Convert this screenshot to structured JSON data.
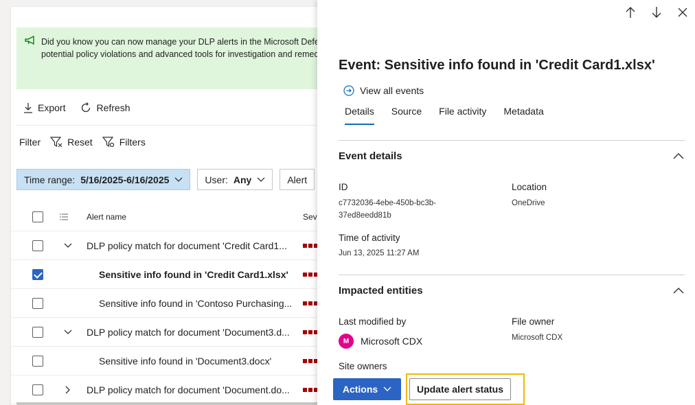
{
  "left": {
    "banner_line1": "Did you know you can now manage your DLP alerts in the Microsoft Defende",
    "banner_line2": "potential policy violations and advanced tools for investigation and remediati",
    "toolbar": {
      "export": "Export",
      "refresh": "Refresh"
    },
    "filter": {
      "label": "Filter",
      "reset": "Reset",
      "filters": "Filters"
    },
    "chips": {
      "time_label": "Time range:",
      "time_value": "5/16/2025-6/16/2025",
      "user_label": "User:",
      "user_value": "Any",
      "alert_label": "Alert"
    },
    "table": {
      "col_alert_name": "Alert name",
      "col_severity": "Seve",
      "rows": [
        {
          "name": "DLP policy match for document 'Credit Card1...",
          "type": "parent",
          "expanded": true,
          "checked": false
        },
        {
          "name": "Sensitive info found in 'Credit Card1.xlsx'",
          "type": "child",
          "checked": true
        },
        {
          "name": "Sensitive info found in 'Contoso Purchasing...",
          "type": "child",
          "checked": false
        },
        {
          "name": "DLP policy match for document 'Document3.d...",
          "type": "parent",
          "expanded": true,
          "checked": false
        },
        {
          "name": "Sensitive info found in 'Document3.docx'",
          "type": "child",
          "checked": false
        },
        {
          "name": "DLP policy match for document 'Document.do...",
          "type": "parent",
          "expanded": false,
          "checked": false
        }
      ]
    }
  },
  "panel": {
    "title": "Event: Sensitive info found in 'Credit Card1.xlsx'",
    "view_all": "View all events",
    "tabs": [
      "Details",
      "Source",
      "File activity",
      "Metadata"
    ],
    "active_tab": "Details",
    "event_details": {
      "heading": "Event details",
      "id_label": "ID",
      "id_line1": "c7732036-4ebe-450b-bc3b-",
      "id_line2": "37ed8eedd81b",
      "location_label": "Location",
      "location_value": "OneDrive",
      "time_label": "Time of activity",
      "time_value": "Jun 13, 2025 11:27 AM"
    },
    "impacted": {
      "heading": "Impacted entities",
      "modified_label": "Last modified by",
      "modified_initial": "M",
      "modified_value": "Microsoft CDX",
      "owner_label": "File owner",
      "owner_value": "Microsoft CDX",
      "site_owners_label": "Site owners"
    },
    "footer": {
      "actions": "Actions",
      "update": "Update alert status",
      "highlight_color": "#f2b705"
    }
  },
  "colors": {
    "primary": "#2b64c2",
    "banner": "#dff6dd",
    "severity": "#a80000",
    "avatar": "#e3008c"
  }
}
